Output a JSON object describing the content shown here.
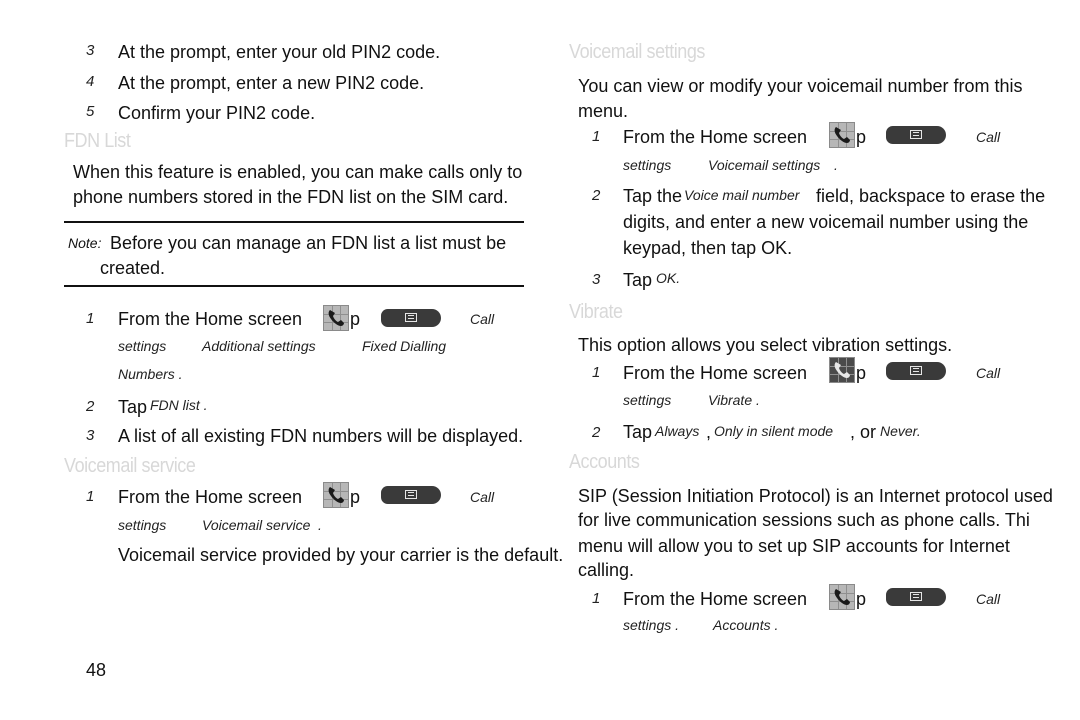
{
  "page_number": "48",
  "left": {
    "pin_steps": [
      {
        "num": "3",
        "text": "At the prompt, enter your old PIN2 code."
      },
      {
        "num": "4",
        "text": "At the prompt, enter a new PIN2 code."
      },
      {
        "num": "5",
        "text": "Confirm your PIN2 code."
      }
    ],
    "fdn": {
      "heading": "FDN List",
      "para_line1": "When this feature is enabled, you can make calls only to",
      "para_line2": "phone numbers stored in the FDN list on the SIM card.",
      "note_label": "Note:",
      "note_line1": "Before you can manage an FDN list a list must be",
      "note_line2": "created.",
      "step1": {
        "num": "1",
        "text": "From the Home screen",
        "tap_suffix": "p",
        "call": "Call",
        "path": [
          "settings",
          "Additional settings",
          "Fixed Dialling"
        ],
        "path_end": "Numbers ."
      },
      "step2": {
        "num": "2",
        "tap": "Tap",
        "target": "FDN list ."
      },
      "step3": {
        "num": "3",
        "text": "A list of all existing FDN numbers will be displayed."
      }
    },
    "voicemail_service": {
      "heading": "Voicemail service",
      "step1": {
        "num": "1",
        "text": "From the Home screen",
        "tap_suffix": "p",
        "call": "Call",
        "path": [
          "settings",
          "Voicemail service",
          "."
        ]
      },
      "para": "Voicemail service provided by your carrier is the default."
    }
  },
  "right": {
    "voicemail_settings": {
      "heading": "Voicemail settings",
      "para_line1": "You can view or modify your voicemail number from this",
      "para_line2": "menu.",
      "step1": {
        "num": "1",
        "text": "From the Home screen",
        "tap_suffix": "p",
        "call": "Call",
        "path": [
          "settings",
          "Voicemail settings",
          "."
        ]
      },
      "step2": {
        "num": "2",
        "lead": "Tap the",
        "field": "Voice mail number",
        "line1_rest": "field, backspace to erase the",
        "line2": "digits, and enter a new voicemail number using the",
        "line3": "keypad, then tap OK."
      },
      "step3": {
        "num": "3",
        "tap": "Tap",
        "target": "OK."
      }
    },
    "vibrate": {
      "heading": "Vibrate",
      "para": "This option allows you select vibration settings.",
      "step1": {
        "num": "1",
        "text": "From the Home screen",
        "tap_suffix": "p",
        "call": "Call",
        "path": [
          "settings",
          "Vibrate ."
        ]
      },
      "step2": {
        "num": "2",
        "tap": "Tap",
        "opt1": "Always",
        "sep1": ",",
        "opt2": "Only in silent mode",
        "sep2": ", or",
        "opt3": "Never."
      }
    },
    "accounts": {
      "heading": "Accounts",
      "para_line1": "SIP (Session Initiation Protocol) is an Internet protocol used",
      "para_line2": "for live communication sessions such as phone calls. Thi",
      "para_line3": "menu will allow you to set up SIP accounts for Internet",
      "para_line4": "calling.",
      "step1": {
        "num": "1",
        "text": "From the Home screen",
        "tap_suffix": "p",
        "call": "Call",
        "path": [
          "settings .",
          "Accounts ."
        ]
      }
    }
  }
}
